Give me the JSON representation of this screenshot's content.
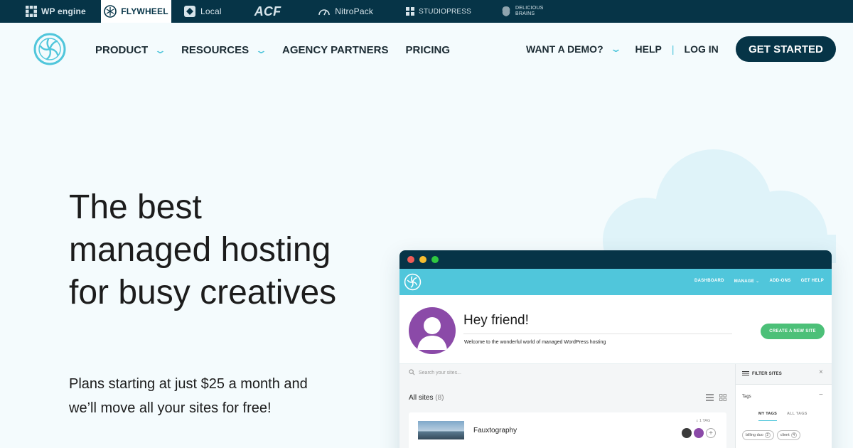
{
  "brandbar": {
    "items": [
      {
        "label": "WP engine",
        "icon": "wpengine-grid-icon",
        "active": false
      },
      {
        "label": "FLYWHEEL",
        "icon": "flywheel-logo-icon",
        "active": true
      },
      {
        "label": "Local",
        "icon": "local-logo-icon",
        "active": false
      },
      {
        "label": "ACF",
        "icon": "",
        "active": false
      },
      {
        "label": "NitroPack",
        "icon": "gauge-icon",
        "active": false
      },
      {
        "label": "STUDIOPRESS",
        "icon": "studiopress-logo-icon",
        "active": false
      },
      {
        "label": "DELICIOUS BRAINS",
        "icon": "brain-logo-icon",
        "active": false
      }
    ]
  },
  "nav": {
    "product": "PRODUCT",
    "resources": "RESOURCES",
    "agency": "AGENCY PARTNERS",
    "pricing": "PRICING",
    "demo": "WANT A DEMO?",
    "help": "HELP",
    "login": "LOG IN",
    "cta": "GET STARTED"
  },
  "hero": {
    "title": "The best managed hosting for busy creatives",
    "subtitle": "Plans starting at just $25 a month and we’ll move all your sites for free!"
  },
  "mockup": {
    "window_dots": [
      "#ef5b57",
      "#f5bd30",
      "#2fc840"
    ],
    "nav_links": [
      "DASHBOARD",
      "MANAGE",
      "ADD-ONS",
      "GET HELP"
    ],
    "greeting": "Hey friend!",
    "welcome": "Welcome to the wonderful world of managed WordPress hosting",
    "create_button": "CREATE A NEW SITE",
    "search_placeholder": "Search your sites...",
    "all_sites_label": "All sites",
    "all_sites_count": "(8)",
    "site_name": "Fauxtography",
    "tag_count": "1 TAG",
    "filter_title": "FILTER SITES",
    "tags_label": "Tags",
    "tab_my": "MY TAGS",
    "tab_all": "ALL TAGS",
    "chips": [
      {
        "label": "billing duo",
        "n": "2"
      },
      {
        "label": "client",
        "n": "4"
      }
    ]
  },
  "colors": {
    "navy": "#063447",
    "accent": "#50c6db",
    "green": "#4cc078",
    "purple": "#8b4aa8"
  }
}
